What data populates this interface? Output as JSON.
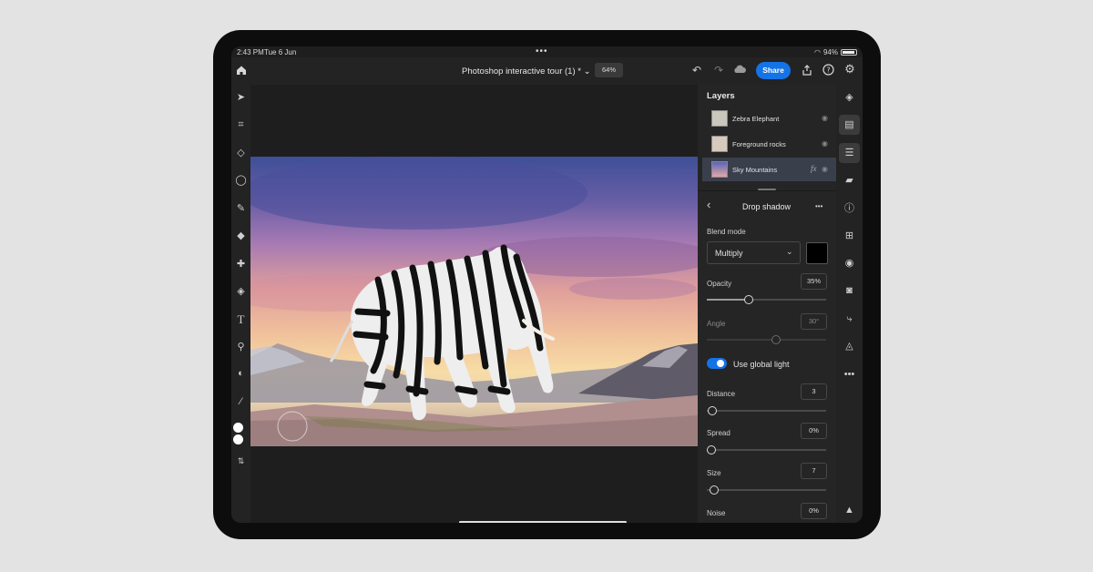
{
  "status_bar": {
    "time": "2:43 PM",
    "date": "Tue 6 Jun",
    "dots": "•••",
    "battery": "94%",
    "battery_level": 0.94
  },
  "top_bar": {
    "home_icon": "home-icon",
    "doc_title": "Photoshop interactive tour (1) * ⌄",
    "zoom": "64%",
    "share_label": "Share",
    "accent": "#1473e6"
  },
  "layers_panel": {
    "title": "Layers",
    "layers": [
      {
        "name": "Zebra Elephant",
        "selected": false
      },
      {
        "name": "Foreground rocks",
        "selected": false
      },
      {
        "name": "Sky Mountains",
        "selected": true,
        "fx": "fx"
      }
    ]
  },
  "properties": {
    "back": "‹",
    "title": "Drop shadow",
    "more": "•••",
    "blend_mode_label": "Blend mode",
    "blend_mode_value": "Multiply",
    "shadow_color": "#000000",
    "opacity_label": "Opacity",
    "opacity_value": "35%",
    "opacity_level": 0.35,
    "angle_label": "Angle",
    "angle_value": "30°",
    "use_global_light_label": "Use global light",
    "use_global_light": true,
    "distance_label": "Distance",
    "distance_value": "3",
    "spread_label": "Spread",
    "spread_value": "0%",
    "size_label": "Size",
    "size_value": "7",
    "noise_label": "Noise",
    "noise_value": "0%"
  }
}
